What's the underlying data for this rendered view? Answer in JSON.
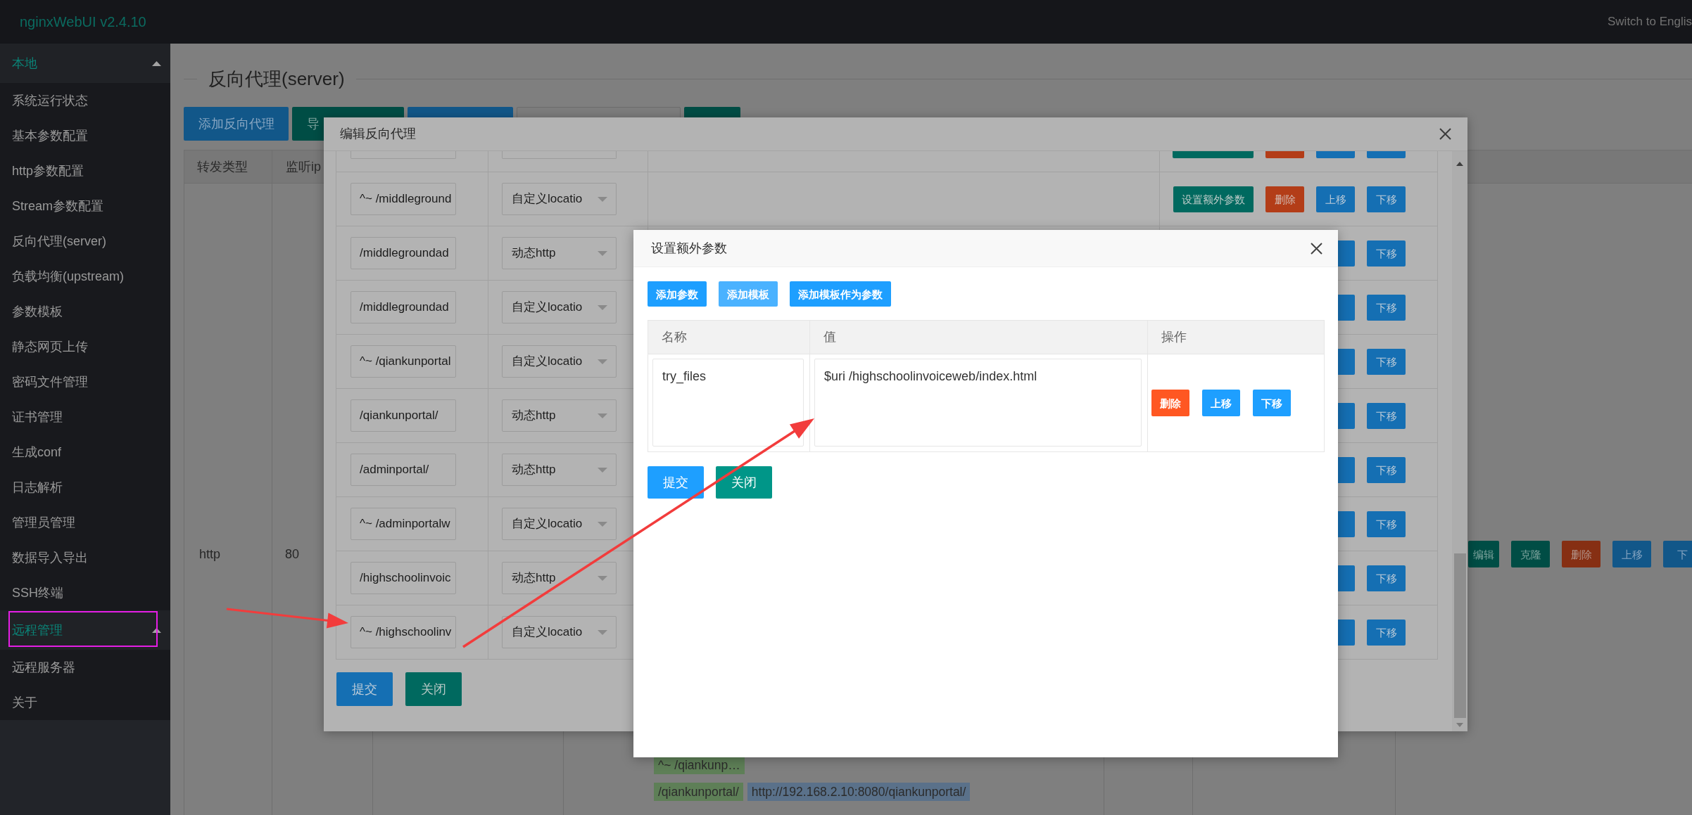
{
  "app": {
    "title": "nginxWebUI v2.4.10",
    "language_link": "Switch to Englis"
  },
  "sidebar": {
    "groups": [
      {
        "label": "本地",
        "expanded": true,
        "items": [
          "系统运行状态",
          "基本参数配置",
          "http参数配置",
          "Stream参数配置",
          "反向代理(server)",
          "负载均衡(upstream)",
          "参数模板",
          "静态网页上传",
          "密码文件管理",
          "证书管理",
          "生成conf",
          "日志解析",
          "管理员管理",
          "数据导入导出",
          "SSH终端"
        ]
      },
      {
        "label": "远程管理",
        "expanded": true,
        "items": [
          "远程服务器",
          "关于"
        ]
      }
    ]
  },
  "page": {
    "title": "反向代理(server)",
    "toolbar": [
      {
        "kind": "normal",
        "label": "添加反向代理"
      },
      {
        "kind": "default",
        "label": "导"
      },
      {
        "kind": "normal"
      },
      {
        "kind": "field"
      },
      {
        "kind": "default"
      }
    ],
    "table": {
      "columns": [
        "转发类型",
        "监听ip"
      ],
      "rows": [
        {
          "type": "http",
          "port": "80",
          "locations": [
            {
              "path": "^~ /qiankunp…"
            },
            {
              "path": "/qiankunportal/",
              "target": "http://192.168.2.10:8080/qiankunportal/"
            }
          ],
          "actions": [
            {
              "kind": "default",
              "label": "编辑"
            },
            {
              "kind": "default",
              "label": "克隆"
            },
            {
              "kind": "danger",
              "label": "删除"
            },
            {
              "kind": "normal",
              "label": "上移"
            },
            {
              "kind": "normal",
              "label": "下"
            }
          ]
        }
      ]
    }
  },
  "edit_dialog": {
    "title": "编辑反向代理",
    "rows": [
      {
        "cut_off": true,
        "actions": [
          {
            "kind": "default"
          },
          {
            "kind": "danger"
          },
          {
            "kind": "normal"
          },
          {
            "kind": "normal"
          }
        ]
      },
      {
        "cut_off": false,
        "path": "^~ /middleground",
        "mode": "自定义locatio",
        "actions": [
          {
            "kind": "default",
            "label": "设置额外参数"
          },
          {
            "kind": "danger",
            "label": "删除"
          },
          {
            "kind": "normal",
            "label": "上移"
          },
          {
            "kind": "normal",
            "label": "下移"
          }
        ]
      },
      {
        "cut_off": false,
        "path": "/middlegroundad",
        "mode": "动态http",
        "actions": [
          {
            "kind": "normal"
          },
          {
            "kind": "normal",
            "label": "下移"
          }
        ]
      },
      {
        "cut_off": false,
        "path": "/middlegroundad",
        "mode": "自定义locatio",
        "actions": [
          {
            "kind": "normal"
          },
          {
            "kind": "normal",
            "label": "下移"
          }
        ]
      },
      {
        "cut_off": false,
        "path": "^~ /qiankunportal",
        "mode": "自定义locatio",
        "actions": [
          {
            "kind": "normal"
          },
          {
            "kind": "normal",
            "label": "下移"
          }
        ]
      },
      {
        "cut_off": false,
        "path": "/qiankunportal/",
        "mode": "动态http",
        "actions": [
          {
            "kind": "normal"
          },
          {
            "kind": "normal",
            "label": "下移"
          }
        ]
      },
      {
        "cut_off": false,
        "path": "/adminportal/",
        "mode": "动态http",
        "actions": [
          {
            "kind": "normal"
          },
          {
            "kind": "normal",
            "label": "下移"
          }
        ]
      },
      {
        "cut_off": false,
        "path": "^~ /adminportalw",
        "mode": "自定义locatio",
        "actions": [
          {
            "kind": "normal"
          },
          {
            "kind": "normal",
            "label": "下移"
          }
        ]
      },
      {
        "cut_off": false,
        "path": "/highschoolinvoic",
        "mode": "动态http",
        "actions": [
          {
            "kind": "normal"
          },
          {
            "kind": "normal",
            "label": "下移"
          }
        ]
      },
      {
        "cut_off": false,
        "path": "^~ /highschoolinv",
        "mode": "自定义locatio",
        "actions": [
          {
            "kind": "normal"
          },
          {
            "kind": "normal",
            "label": "下移"
          }
        ]
      }
    ],
    "buttons": [
      {
        "kind": "normal",
        "label": "提交"
      },
      {
        "kind": "default",
        "label": "关闭"
      }
    ]
  },
  "params_dialog": {
    "title": "设置额外参数",
    "toolbar": [
      {
        "kind": "normal",
        "label": "添加参数",
        "hovered": false
      },
      {
        "kind": "normal",
        "label": "添加模板",
        "hovered": true
      },
      {
        "kind": "normal",
        "label": "添加模板作为参数",
        "hovered": false
      }
    ],
    "columns": [
      "名称",
      "值",
      "操作"
    ],
    "rows": [
      {
        "name": "try_files",
        "value": "$uri /highschoolinvoiceweb/index.html",
        "actions": [
          {
            "kind": "danger",
            "label": "删除"
          },
          {
            "kind": "normal",
            "label": "上移"
          },
          {
            "kind": "normal",
            "label": "下移"
          }
        ]
      }
    ],
    "buttons": [
      {
        "kind": "normal",
        "label": "提交"
      },
      {
        "kind": "default",
        "label": "关闭"
      }
    ]
  }
}
